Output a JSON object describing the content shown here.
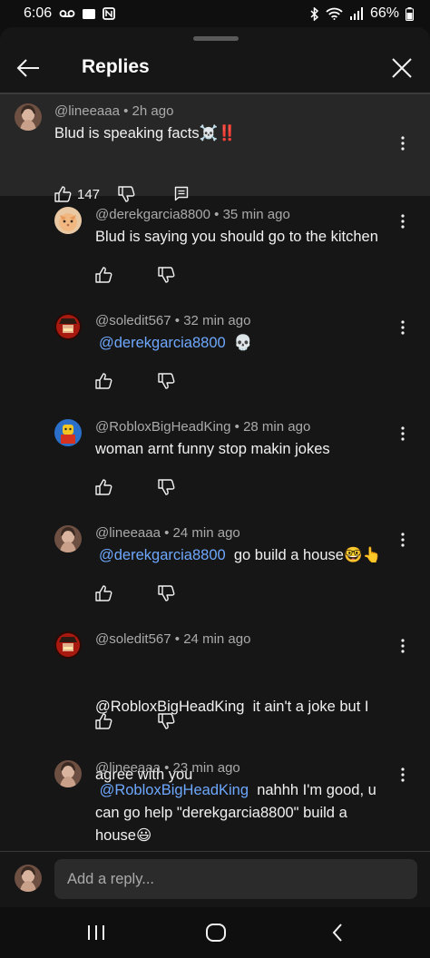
{
  "status": {
    "time": "6:06",
    "battery": "66%"
  },
  "sheet": {
    "title": "Replies",
    "reply_placeholder": "Add a reply..."
  },
  "parent": {
    "handle": "@lineeaaa",
    "age": "2h ago",
    "text": "Blud is speaking facts",
    "emoji": "☠️‼️",
    "likes": "147"
  },
  "replies": [
    {
      "handle": "@derekgarcia8800",
      "age": "35 min ago",
      "mention": "",
      "text": "Blud is saying you should go to the kitchen",
      "emoji": ""
    },
    {
      "handle": "@soledit567",
      "age": "32 min ago",
      "mention": "@derekgarcia8800",
      "text": "",
      "emoji": "💀"
    },
    {
      "handle": "@RobloxBigHeadKing",
      "age": "28 min ago",
      "mention": "",
      "text": "woman arnt funny stop makin jokes",
      "emoji": ""
    },
    {
      "handle": "@lineeaaa",
      "age": "24 min ago",
      "mention": "@derekgarcia8800",
      "text": "go build a house",
      "emoji": "🤓👆"
    },
    {
      "handle": "@soledit567",
      "age": "24 min ago",
      "mention": "",
      "text1": "@RobloxBigHeadKing  it ain't a joke but I",
      "text2": "agree with you",
      "emoji": ""
    },
    {
      "handle": "@lineeaaa",
      "age": "23 min ago",
      "mention": "@RobloxBigHeadKing",
      "text1": "nahhh I'm good, u",
      "text2": "can go help \"derekgarcia8800\" build a",
      "text3": "house",
      "emoji": "😃"
    }
  ],
  "colors": {
    "background": "#0f0f0f",
    "sheet": "#161616",
    "highlight": "#272727",
    "mention": "#6ea8fe",
    "meta": "#aaaaaa"
  },
  "icons": [
    "voicemail-icon",
    "gallery-icon",
    "nfc-icon",
    "bluetooth-icon",
    "wifi-icon",
    "signal-icon",
    "battery-icon",
    "back-arrow-icon",
    "close-icon",
    "more-vert-icon",
    "thumb-up-icon",
    "thumb-down-icon",
    "reply-icon",
    "recents-icon",
    "home-icon",
    "nav-back-icon"
  ]
}
